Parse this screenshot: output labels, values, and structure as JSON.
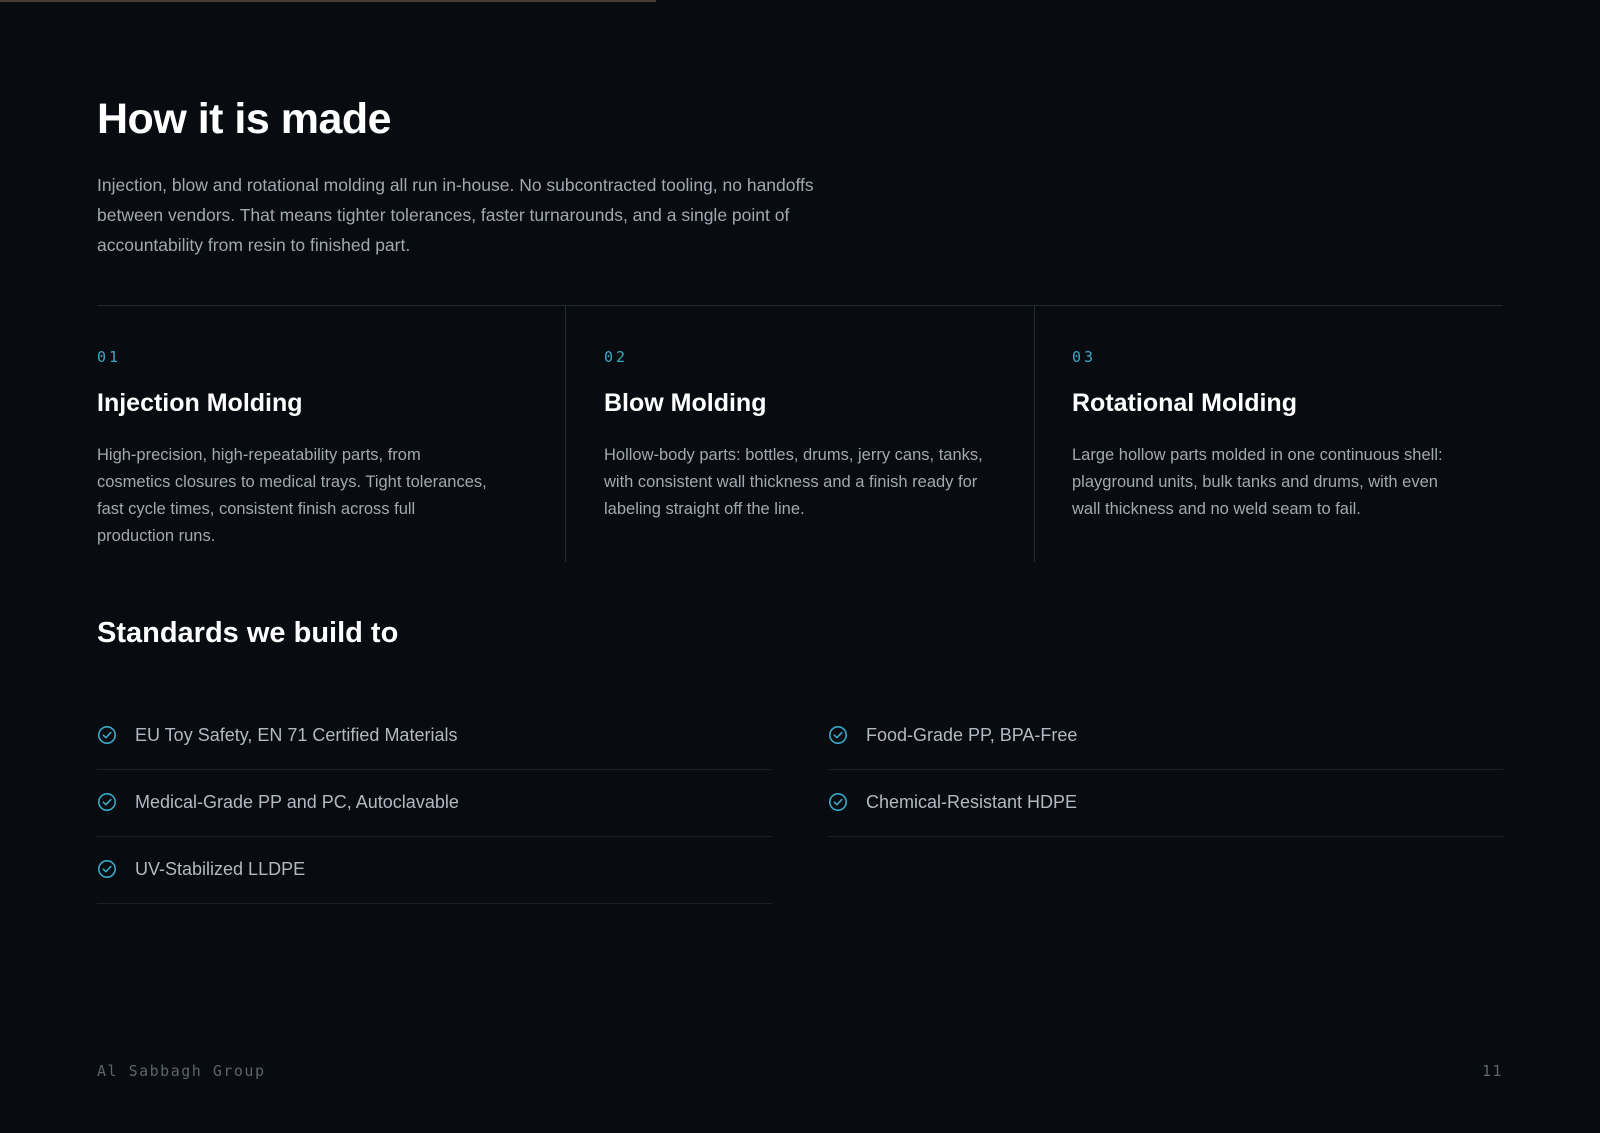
{
  "progress": {
    "fraction": 0.41,
    "color": "#4a3b31"
  },
  "section": {
    "title": "How it is made",
    "intro": "Injection, blow and rotational molding all run in-house. No subcontracted tooling, no handoffs between vendors. That means tighter tolerances, faster turnarounds, and a single point of accountability from resin to finished part."
  },
  "methods": [
    {
      "number": "01",
      "title": "Injection Molding",
      "description": "High-precision, high-repeatability parts, from cosmetics closures to medical trays. Tight tolerances, fast cycle times, consistent finish across full production runs."
    },
    {
      "number": "02",
      "title": "Blow Molding",
      "description": "Hollow-body parts: bottles, drums, jerry cans, tanks, with consistent wall thickness and a finish ready for labeling straight off the line."
    },
    {
      "number": "03",
      "title": "Rotational Molding",
      "description": "Large hollow parts molded in one continuous shell: playground units, bulk tanks and drums, with even wall thickness and no weld seam to fail."
    }
  ],
  "standards": {
    "title": "Standards we build to",
    "icon": "check-circle-icon",
    "accent_color": "#3aa9c8",
    "left": [
      {
        "label": "EU Toy Safety, EN 71 Certified Materials"
      },
      {
        "label": "Medical-Grade PP and PC, Autoclavable"
      },
      {
        "label": "UV-Stabilized LLDPE"
      }
    ],
    "right": [
      {
        "label": "Food-Grade PP, BPA-Free"
      },
      {
        "label": "Chemical-Resistant HDPE"
      }
    ]
  },
  "footer": {
    "brand": "Al Sabbagh Group",
    "page_number": "11"
  }
}
